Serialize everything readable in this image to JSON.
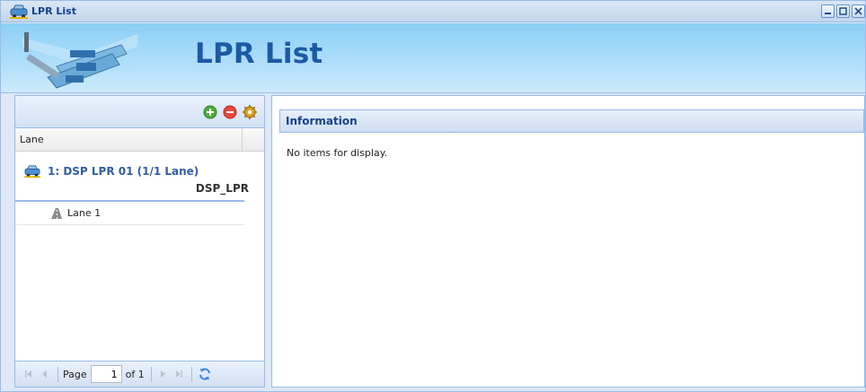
{
  "window": {
    "title": "LPR List",
    "icon": "car-icon",
    "controls": [
      "minimize-icon",
      "maximize-icon",
      "close-icon"
    ]
  },
  "banner": {
    "title": "LPR List",
    "logo_icon": "lanes-logo"
  },
  "left_panel": {
    "toolbar": {
      "add_icon": "add-icon",
      "remove_icon": "remove-icon",
      "settings_icon": "gear-icon"
    },
    "grid": {
      "column_header": "Lane",
      "group": {
        "title": "1: DSP LPR 01 (1/1 Lane)",
        "subtitle": "DSP_LPR"
      },
      "rows": [
        {
          "label": "Lane 1",
          "icon": "road-icon"
        }
      ]
    },
    "pager": {
      "page_label": "Page",
      "page_value": "1",
      "of_label": "of 1"
    }
  },
  "right_panel": {
    "header": "Information",
    "empty_text": "No items for display."
  },
  "colors": {
    "accent": "#15428b",
    "border": "#99bbe8",
    "banner_title": "#1c5aa6"
  }
}
